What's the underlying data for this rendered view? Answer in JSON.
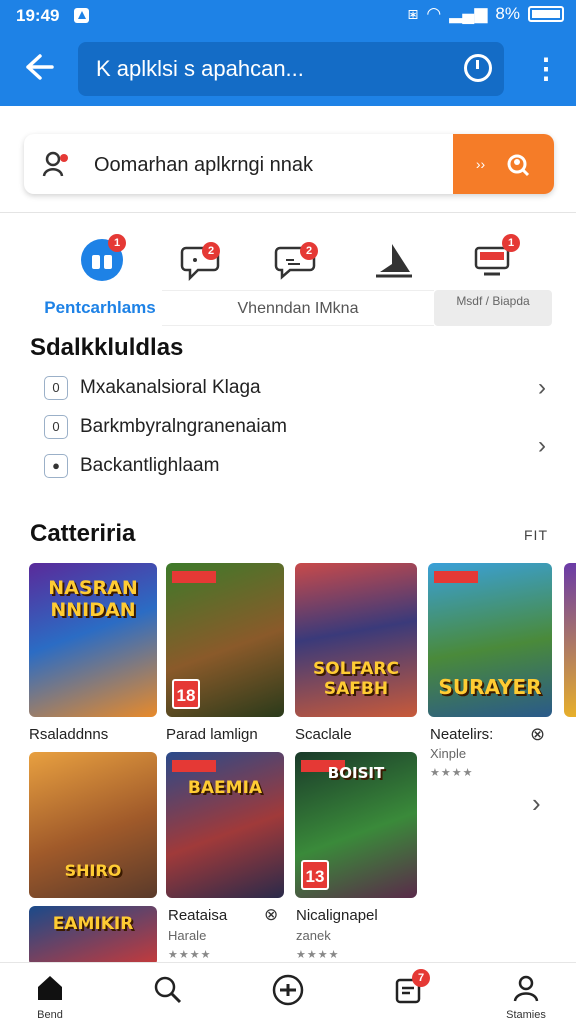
{
  "status_bar": {
    "time": "19:49",
    "battery": "8%"
  },
  "app_bar": {
    "search_text": "K aplklsi s apahcan..."
  },
  "search_card": {
    "placeholder": "Oomarhan aplkrngi nnak",
    "button_label": "››"
  },
  "categories": {
    "icons": [
      {
        "name": "gift-icon",
        "badge": "1"
      },
      {
        "name": "chat-icon",
        "badge": "2"
      },
      {
        "name": "message-icon",
        "badge": "2"
      },
      {
        "name": "notification-icon",
        "badge": ""
      },
      {
        "name": "tv-icon",
        "badge": "1"
      }
    ],
    "tabs": {
      "active": "Pentcarhlams",
      "middle": "Vhenndan IMkna",
      "right": "Msdf / Biapda"
    }
  },
  "section1": {
    "title": "Sdalkkluldlas",
    "rows": [
      {
        "icon": "0",
        "label": "Mxakanalsioral Klaga"
      },
      {
        "icon": "0",
        "label": "Barkmbyralngranenaiam"
      },
      {
        "icon": "●",
        "label": "Backantlighlaam"
      }
    ]
  },
  "section2": {
    "title": "Catteriria",
    "filter": "FIT",
    "games_row1": [
      {
        "title": "NASRAN NNIDAN",
        "label": "Rsaladdnns",
        "sub": "",
        "age": ""
      },
      {
        "title": "",
        "label": "Parad lamlign",
        "sub": "",
        "age": "18"
      },
      {
        "title": "SOLFARC SAFBH",
        "label": "Scaclale",
        "sub": "",
        "age": ""
      },
      {
        "title": "SURAYER",
        "label": "Neatelirs:",
        "sub": "Xinple",
        "age": ""
      }
    ],
    "games_row2": [
      {
        "title": "SHIRO",
        "label": "",
        "sub": "",
        "age": ""
      },
      {
        "title": "BAEMIA",
        "label": "Reataisa",
        "sub": "Harale",
        "age": ""
      },
      {
        "title": "BOISIT",
        "label": "Nicalignapel",
        "sub": "zanek",
        "age": "13"
      }
    ],
    "games_row3": [
      {
        "title": "EAMIKIR"
      }
    ],
    "stars": "★★★★"
  },
  "bottom_nav": [
    {
      "name": "home",
      "label": "Bend"
    },
    {
      "name": "search",
      "label": ""
    },
    {
      "name": "add",
      "label": ""
    },
    {
      "name": "inbox",
      "label": "",
      "badge": "7"
    },
    {
      "name": "profile",
      "label": "Stamies"
    }
  ],
  "colors": {
    "primary": "#1e82e6",
    "accent": "#f57c28",
    "badge": "#e53935"
  }
}
